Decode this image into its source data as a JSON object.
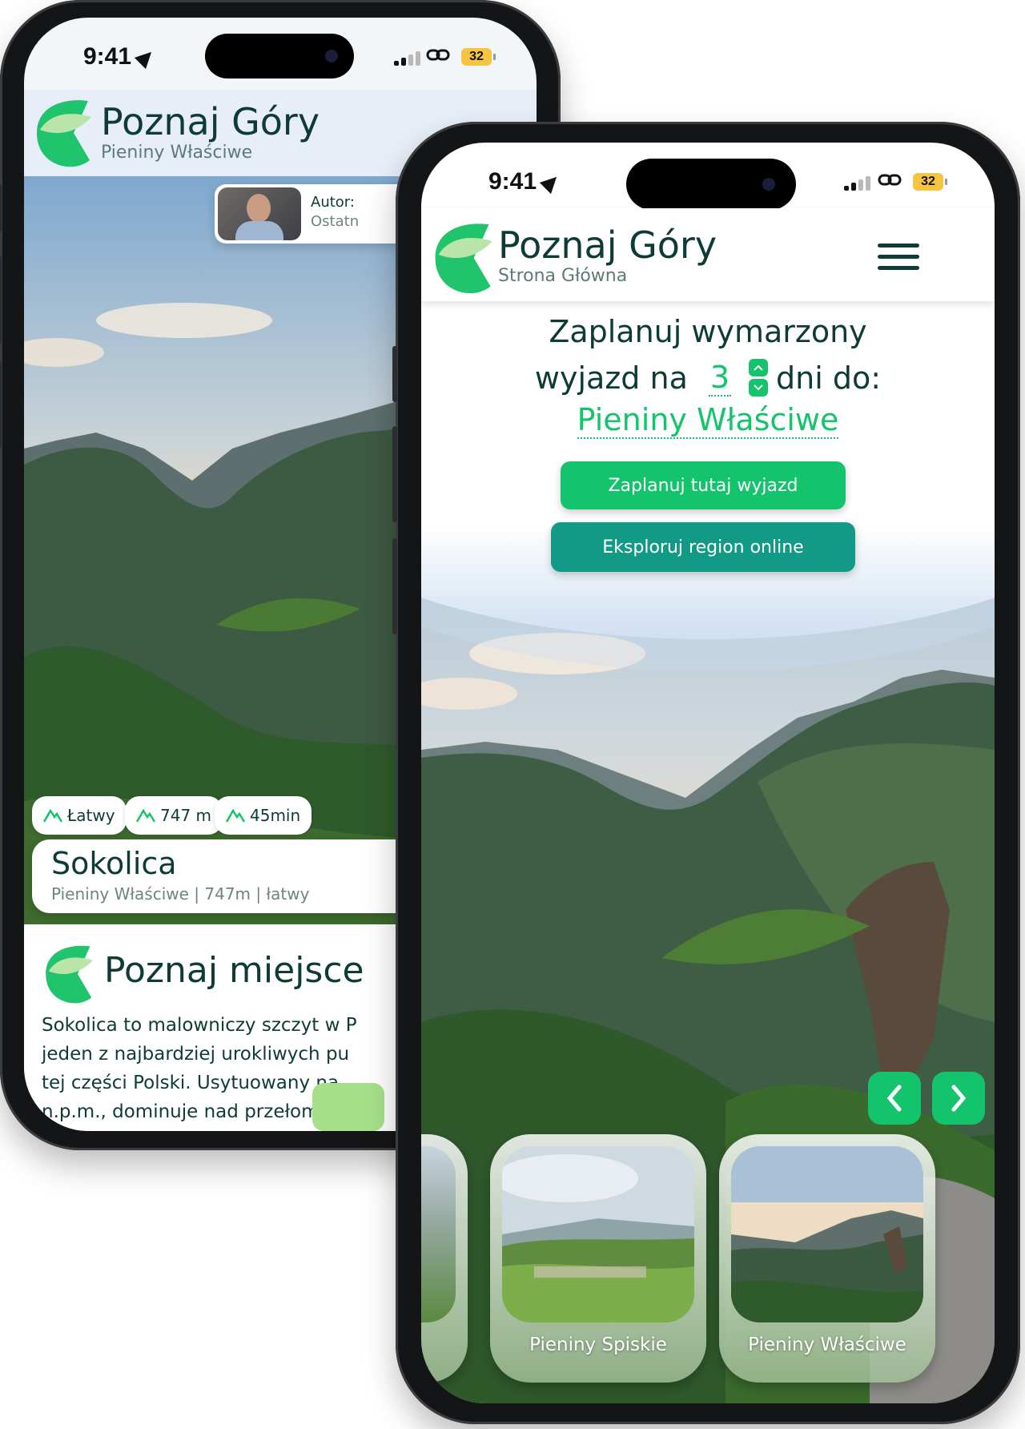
{
  "back_phone": {
    "status": {
      "time": "9:41",
      "battery": "32"
    },
    "header": {
      "title": "Poznaj Góry",
      "subtitle": "Pieniny Właściwe"
    },
    "author": {
      "label": "Autor:",
      "sub": "Ostatn"
    },
    "chips": [
      {
        "icon": "mountain-icon",
        "label": "Łatwy"
      },
      {
        "icon": "mountain-icon",
        "label": "747 m"
      },
      {
        "icon": "mountain-icon",
        "label": "45min"
      }
    ],
    "place_card": {
      "title": "Sokolica",
      "meta": "Pieniny Właściwe | 747m | łatwy"
    },
    "section": {
      "title": "Poznaj miejsce"
    },
    "description": [
      "Sokolica to malowniczy szczyt w P",
      "jeden z najbardziej urokliwych pu",
      "tej części Polski. Usytuowany na",
      "n.p.m., dominuje nad przełomem D"
    ]
  },
  "front_phone": {
    "status": {
      "time": "9:41",
      "battery": "32"
    },
    "header": {
      "title": "Poznaj Góry",
      "subtitle": "Strona Główna"
    },
    "planner": {
      "line1": "Zaplanuj wymarzony",
      "prefix": "wyjazd na",
      "days": "3",
      "suffix": "dni do:",
      "destination": "Pieniny Właściwe"
    },
    "buttons": {
      "plan": "Zaplanuj tutaj wyjazd",
      "explore": "Eksploruj region online"
    },
    "regions": [
      {
        "name": ""
      },
      {
        "name": "Pieniny Spiskie"
      },
      {
        "name": "Pieniny Właściwe"
      }
    ]
  },
  "colors": {
    "brand_dark": "#0e3b36",
    "accent_green": "#13c46d",
    "teal": "#129a86"
  }
}
